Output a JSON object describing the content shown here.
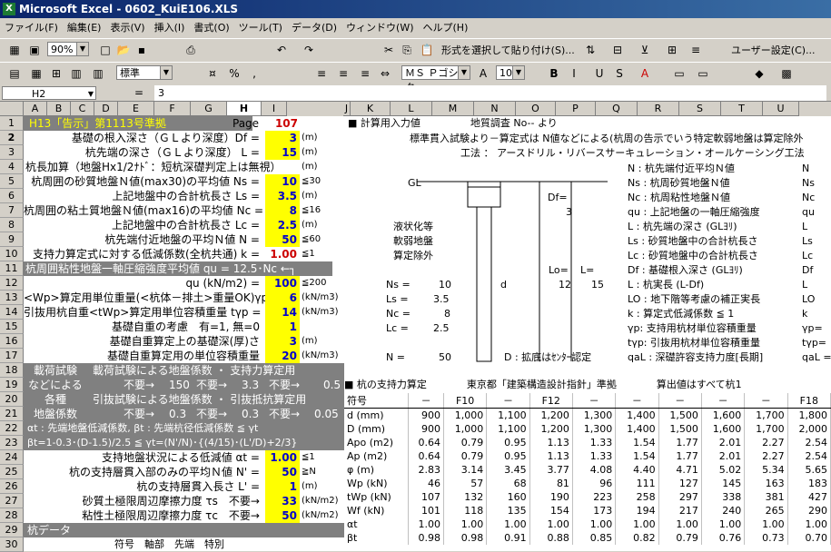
{
  "window": {
    "title": "Microsoft Excel - 0602_KuiE106.XLS"
  },
  "menu": [
    "ファイル(F)",
    "編集(E)",
    "表示(V)",
    "挿入(I)",
    "書式(O)",
    "ツール(T)",
    "データ(D)",
    "ウィンドウ(W)",
    "ヘルプ(H)"
  ],
  "toolbar1": {
    "zoom": "90%",
    "paste_special": "形式を選択して貼り付け(S)...",
    "user_settings": "ユーザー設定(C)..."
  },
  "toolbar2": {
    "style": "標準",
    "font": "ＭＳ Ｐゴシック",
    "size": "10"
  },
  "formula": {
    "cell": "H2",
    "eq": "=",
    "value": "3"
  },
  "columns": [
    "A",
    "B",
    "C",
    "D",
    "E",
    "F",
    "G",
    "H",
    "I",
    "J",
    "K",
    "L",
    "M",
    "N",
    "O",
    "P",
    "Q",
    "R",
    "S",
    "T",
    "U"
  ],
  "rows": [
    "1",
    "2",
    "3",
    "4",
    "5",
    "6",
    "7",
    "8",
    "9",
    "10",
    "11",
    "12",
    "13",
    "14",
    "15",
    "16",
    "17",
    "18",
    "19",
    "20",
    "21",
    "22",
    "23",
    "24",
    "25",
    "26",
    "27",
    "28",
    "29",
    "30"
  ],
  "left": {
    "r1_title": "H13「告示」第1113号準拠",
    "r1_page": "Page",
    "r1_pagenum": "107",
    "r2": "基礎の根入深さ（ＧＬより深度）Df =",
    "r2v": "3",
    "r2u": "(m)",
    "r3": "杭先端の深さ（ＧＬより深度） L =",
    "r3v": "15",
    "r3u": "(m)",
    "r4": "杭長加算（地盤Hx1/2ﾅﾄﾞ：短杭深礎判定上は無視）",
    "r4u": "(m)",
    "r5": "杭周囲の砂質地盤Ｎ値(max30)の平均値 Ns =",
    "r5v": "10",
    "r5u": "≦30",
    "r6": "上記地盤中の合計杭長さ Ls =",
    "r6v": "3.5",
    "r6u": "(m)",
    "r7": "杭周囲の粘土質地盤Ｎ値(max16)の平均値 Nc =",
    "r7v": "8",
    "r7u": "≦16",
    "r8": "上記地盤中の合計杭長さ Lc =",
    "r8v": "2.5",
    "r8u": "(m)",
    "r9": "杭先端付近地盤の平均Ｎ値 N =",
    "r9v": "50",
    "r9u": "≦60",
    "r10": "支持力算定式に対する低減係数(全杭共通) k =",
    "r10v": "1.00",
    "r10u": "≦1",
    "r11": "杭周囲粘性地盤一軸圧縮強度平均値 qu = 12.5･Nc ←┐",
    "r12": "qu (kN/m2) =",
    "r12v": "100",
    "r12u": "≦200",
    "r13": "<Wp>算定用単位重量(<杭体－排土>重量OK)γp =",
    "r13v": "6",
    "r13u": "(kN/m3)",
    "r14": "引抜用杭自重<tWp>算定用単位容積重量 tγp =",
    "r14v": "14",
    "r14u": "(kN/m3)",
    "r15": "基礎自重の考慮　有=1, 無=0",
    "r15v": "1",
    "r16": "基礎自重算定上の基礎深(厚)さ",
    "r16v": "3",
    "r16u": "(m)",
    "r17": "基礎自重算定用の単位容積重量",
    "r17v": "20",
    "r17u": "(kN/m3)",
    "r18a": "載荷試験",
    "r18b": "載荷試験による地盤係数 ・ 支持力算定用",
    "r19a": "などによる",
    "r19b": "不要→",
    "r19c": "150",
    "r19d": "不要→",
    "r19e": "3.3",
    "r19f": "不要→",
    "r19g": "0.5",
    "r20a": "各種",
    "r20b": "引抜試験による地盤係数 ・ 引抜抵抗算定用",
    "r21a": "地盤係数",
    "r21b": "不要→",
    "r21c": "0.3",
    "r21d": "不要→",
    "r21e": "0.3",
    "r21f": "不要→",
    "r21g": "0.05",
    "r22": "αt : 先端地盤低減係数, βt : 先端杭径低減係数 ≦ γt",
    "r23": "βt=1-0.3･(D-1.5)/2.5 ≦ γt=(N'/N)･{(4/15)･(L'/D)+2/3}",
    "r24": "支持地盤状況による低減値 αt =",
    "r24v": "1.00",
    "r24u": "≦1",
    "r25": "杭の支持層貫入部のみの平均Ｎ値 N' =",
    "r25v": "50",
    "r25u": "≧N",
    "r26": "杭の支持層貫入長さ L' =",
    "r26v": "1",
    "r26u": "(m)",
    "r27": "砂質土極限周辺摩擦力度 τs　不要→",
    "r27v": "33",
    "r27u": "(kN/m2)",
    "r28": "粘性土極限周辺摩擦力度 τc　不要→",
    "r28v": "50",
    "r28u": "(kN/m2)",
    "r29": "杭データ",
    "r30": "符号　軸部　先端　特別"
  },
  "right": {
    "hdr": "■ 計算用入力値　　　　　地質調査 No-- より",
    "line1": "標準貫入試験より－算定式は N値などによる(杭周の告示でいう特定軟弱地盤は算定除外",
    "line2": "工法 ： アースドリル・リバースサーキュレーション・オールケーシング工法",
    "gl": "GL",
    "df": "Df=",
    "df_v": "3",
    "lo": "Lo=",
    "l": "L=",
    "lo_v": "12",
    "l_v": "15",
    "d": "d",
    "liq1": "液状化等",
    "liq2": "軟弱地盤",
    "liq3": "算定除外",
    "ns": "Ns =",
    "ns_v": "10",
    "ls": "Ls =",
    "ls_v": "3.5",
    "nc": "Nc =",
    "nc_v": "8",
    "lc": "Lc =",
    "lc_v": "2.5",
    "n": "N =",
    "n_v": "50",
    "d_note": "D : 拡底はｾﾝﾀｰ認定",
    "legend": [
      "N : 杭先端付近平均Ｎ値",
      "Ns : 杭周砂質地盤Ｎ値",
      "Nc : 杭周粘性地盤Ｎ値",
      "qu : 上記地盤の一軸圧縮強度",
      "L : 杭先端の深さ (GLﾖﾘ)",
      "Ls : 砂質地盤中の合計杭長さ",
      "Lc : 砂質地盤中の合計杭長さ",
      "Df : 基礎根入深さ (GLﾖﾘ)",
      "L : 杭実長 (L-Df)",
      "LO : 地下階等考慮の補正実長",
      "k : 算定式低減係数 ≦ 1",
      "γp: 支持用杭材単位容積重量",
      "tγp: 引抜用杭材単位容積重量",
      "qaL : 深礎許容支持力度[長期]"
    ],
    "legend2": [
      "N",
      "Ns",
      "Nc",
      "qu",
      "L",
      "Ls",
      "Lc",
      "Df",
      "L",
      "LO",
      "k",
      "γp=",
      "tγp=",
      "qaL ="
    ],
    "table_title": "■ 杭の支持力算定　　　　東京都「建築構造設計指針」準拠　　　　算出値はすべて杭1",
    "table_head": [
      "符号",
      "－",
      "F10",
      "－",
      "F12",
      "－",
      "－",
      "－",
      "－",
      "－",
      "F18"
    ],
    "table_rows": [
      [
        "d (mm)",
        "900",
        "1,000",
        "1,100",
        "1,200",
        "1,300",
        "1,400",
        "1,500",
        "1,600",
        "1,700",
        "1,800"
      ],
      [
        "D (mm)",
        "900",
        "1,000",
        "1,100",
        "1,200",
        "1,300",
        "1,400",
        "1,500",
        "1,600",
        "1,700",
        "2,000"
      ],
      [
        "Apo (m2)",
        "0.64",
        "0.79",
        "0.95",
        "1.13",
        "1.33",
        "1.54",
        "1.77",
        "2.01",
        "2.27",
        "2.54"
      ],
      [
        "Ap (m2)",
        "0.64",
        "0.79",
        "0.95",
        "1.13",
        "1.33",
        "1.54",
        "1.77",
        "2.01",
        "2.27",
        "2.54"
      ],
      [
        "φ (m)",
        "2.83",
        "3.14",
        "3.45",
        "3.77",
        "4.08",
        "4.40",
        "4.71",
        "5.02",
        "5.34",
        "5.65"
      ],
      [
        "Wp (kN)",
        "46",
        "57",
        "68",
        "81",
        "96",
        "111",
        "127",
        "145",
        "163",
        "183"
      ],
      [
        "tWp (kN)",
        "107",
        "132",
        "160",
        "190",
        "223",
        "258",
        "297",
        "338",
        "381",
        "427"
      ],
      [
        "Wf (kN)",
        "101",
        "118",
        "135",
        "154",
        "173",
        "194",
        "217",
        "240",
        "265",
        "290"
      ],
      [
        "αt",
        "1.00",
        "1.00",
        "1.00",
        "1.00",
        "1.00",
        "1.00",
        "1.00",
        "1.00",
        "1.00",
        "1.00"
      ],
      [
        "βt",
        "0.98",
        "0.98",
        "0.91",
        "0.88",
        "0.85",
        "0.82",
        "0.79",
        "0.76",
        "0.73",
        "0.70"
      ]
    ]
  },
  "colors": {
    "title_bg": "#0a246a",
    "yellow": "#ffff00",
    "gray": "#808080",
    "red": "#cc0000",
    "blue": "#0000cc"
  }
}
